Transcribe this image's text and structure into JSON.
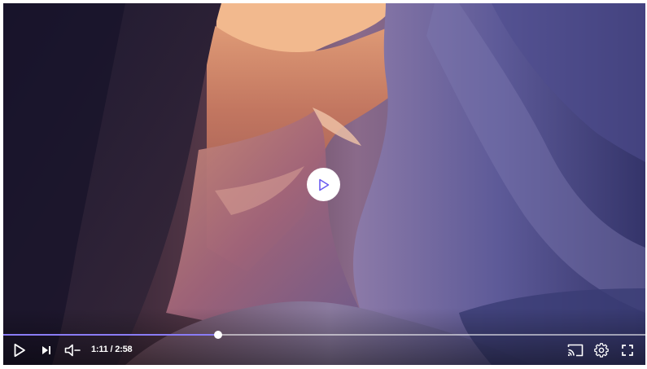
{
  "player": {
    "current_time": "1:11",
    "duration": "2:58",
    "time_separator": " / ",
    "progress_fraction": 0.335,
    "accent_color": "#8a7cf5"
  },
  "icons": {
    "big_play": "play-icon",
    "play": "play-icon",
    "next": "skip-next-icon",
    "volume": "volume-muted-icon",
    "cast": "cast-icon",
    "settings": "gear-icon",
    "fullscreen": "fullscreen-icon"
  }
}
